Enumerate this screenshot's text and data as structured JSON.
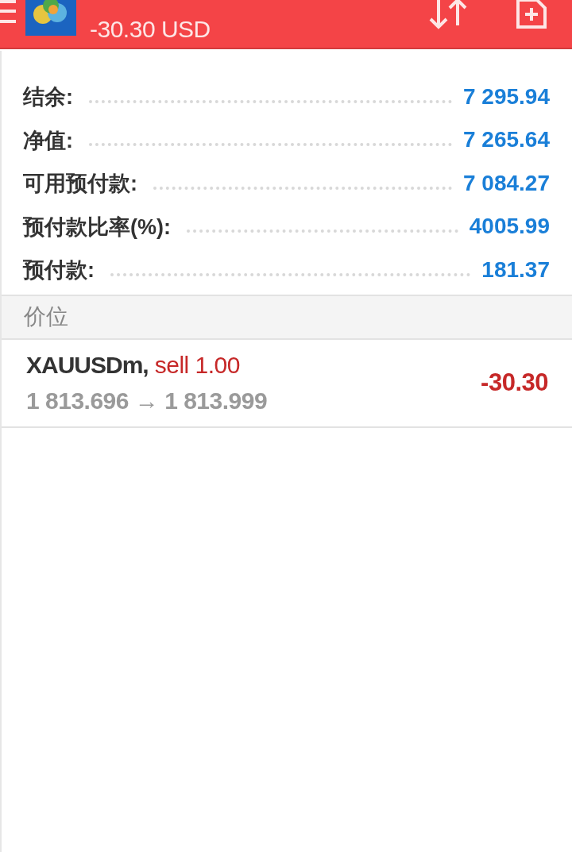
{
  "header": {
    "subtitle": "-30.30 USD"
  },
  "account": [
    {
      "label": "结余:",
      "value": "7 295.94"
    },
    {
      "label": "净值:",
      "value": "7 265.64"
    },
    {
      "label": "可用预付款:",
      "value": "7 084.27"
    },
    {
      "label": "预付款比率(%):",
      "value": "4005.99"
    },
    {
      "label": "预付款:",
      "value": "181.37"
    }
  ],
  "section": {
    "title": "价位"
  },
  "positions": [
    {
      "symbol": "XAUUSDm,",
      "kind": "sell",
      "order": "sell 1.00",
      "prices": "1 813.696 → 1 813.999",
      "profit": "-30.30",
      "loss": true
    }
  ]
}
